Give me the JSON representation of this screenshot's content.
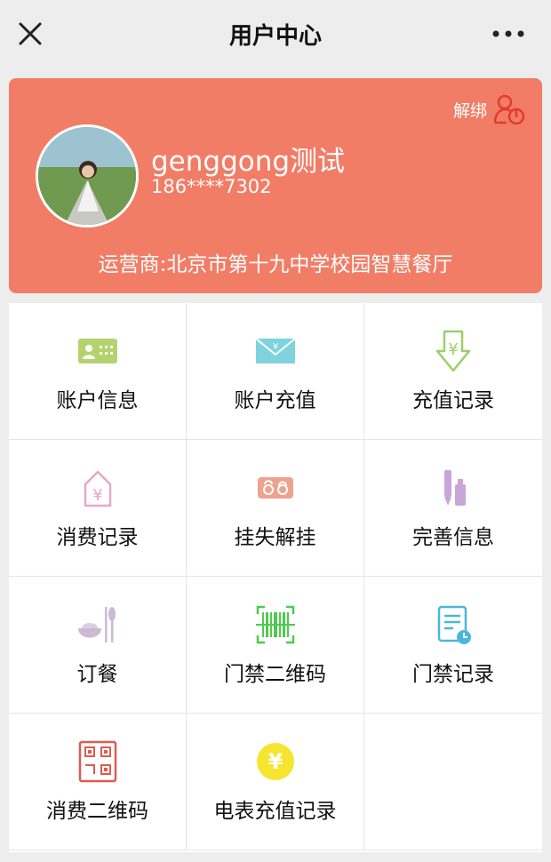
{
  "header": {
    "title": "用户中心"
  },
  "profile": {
    "unbind_label": "解绑",
    "name": "genggong测试",
    "phone": "186****7302",
    "operator": "运营商:北京市第十九中学校园智慧餐厅"
  },
  "menu": [
    {
      "label": "账户信息",
      "icon": "id-card-icon",
      "color": "#b3d36e"
    },
    {
      "label": "账户充值",
      "icon": "envelope-yen-icon",
      "color": "#7fd3dc"
    },
    {
      "label": "充值记录",
      "icon": "yen-down-arrow-icon",
      "color": "#9ccf6b"
    },
    {
      "label": "消费记录",
      "icon": "house-yen-icon",
      "color": "#e6a9c2"
    },
    {
      "label": "挂失解挂",
      "icon": "lock-pair-icon",
      "color": "#eea28f"
    },
    {
      "label": "完善信息",
      "icon": "pen-bottle-icon",
      "color": "#c9a6d8"
    },
    {
      "label": "订餐",
      "icon": "bowl-spoon-icon",
      "color": "#cbbad4"
    },
    {
      "label": "门禁二维码",
      "icon": "barcode-scan-icon",
      "color": "#4fc94f"
    },
    {
      "label": "门禁记录",
      "icon": "document-clock-icon",
      "color": "#49b7dd"
    },
    {
      "label": "消费二维码",
      "icon": "qr-code-icon",
      "color": "#e05a4f"
    },
    {
      "label": "电表充值记录",
      "icon": "yen-circle-icon",
      "color": "#f6e52e"
    }
  ]
}
